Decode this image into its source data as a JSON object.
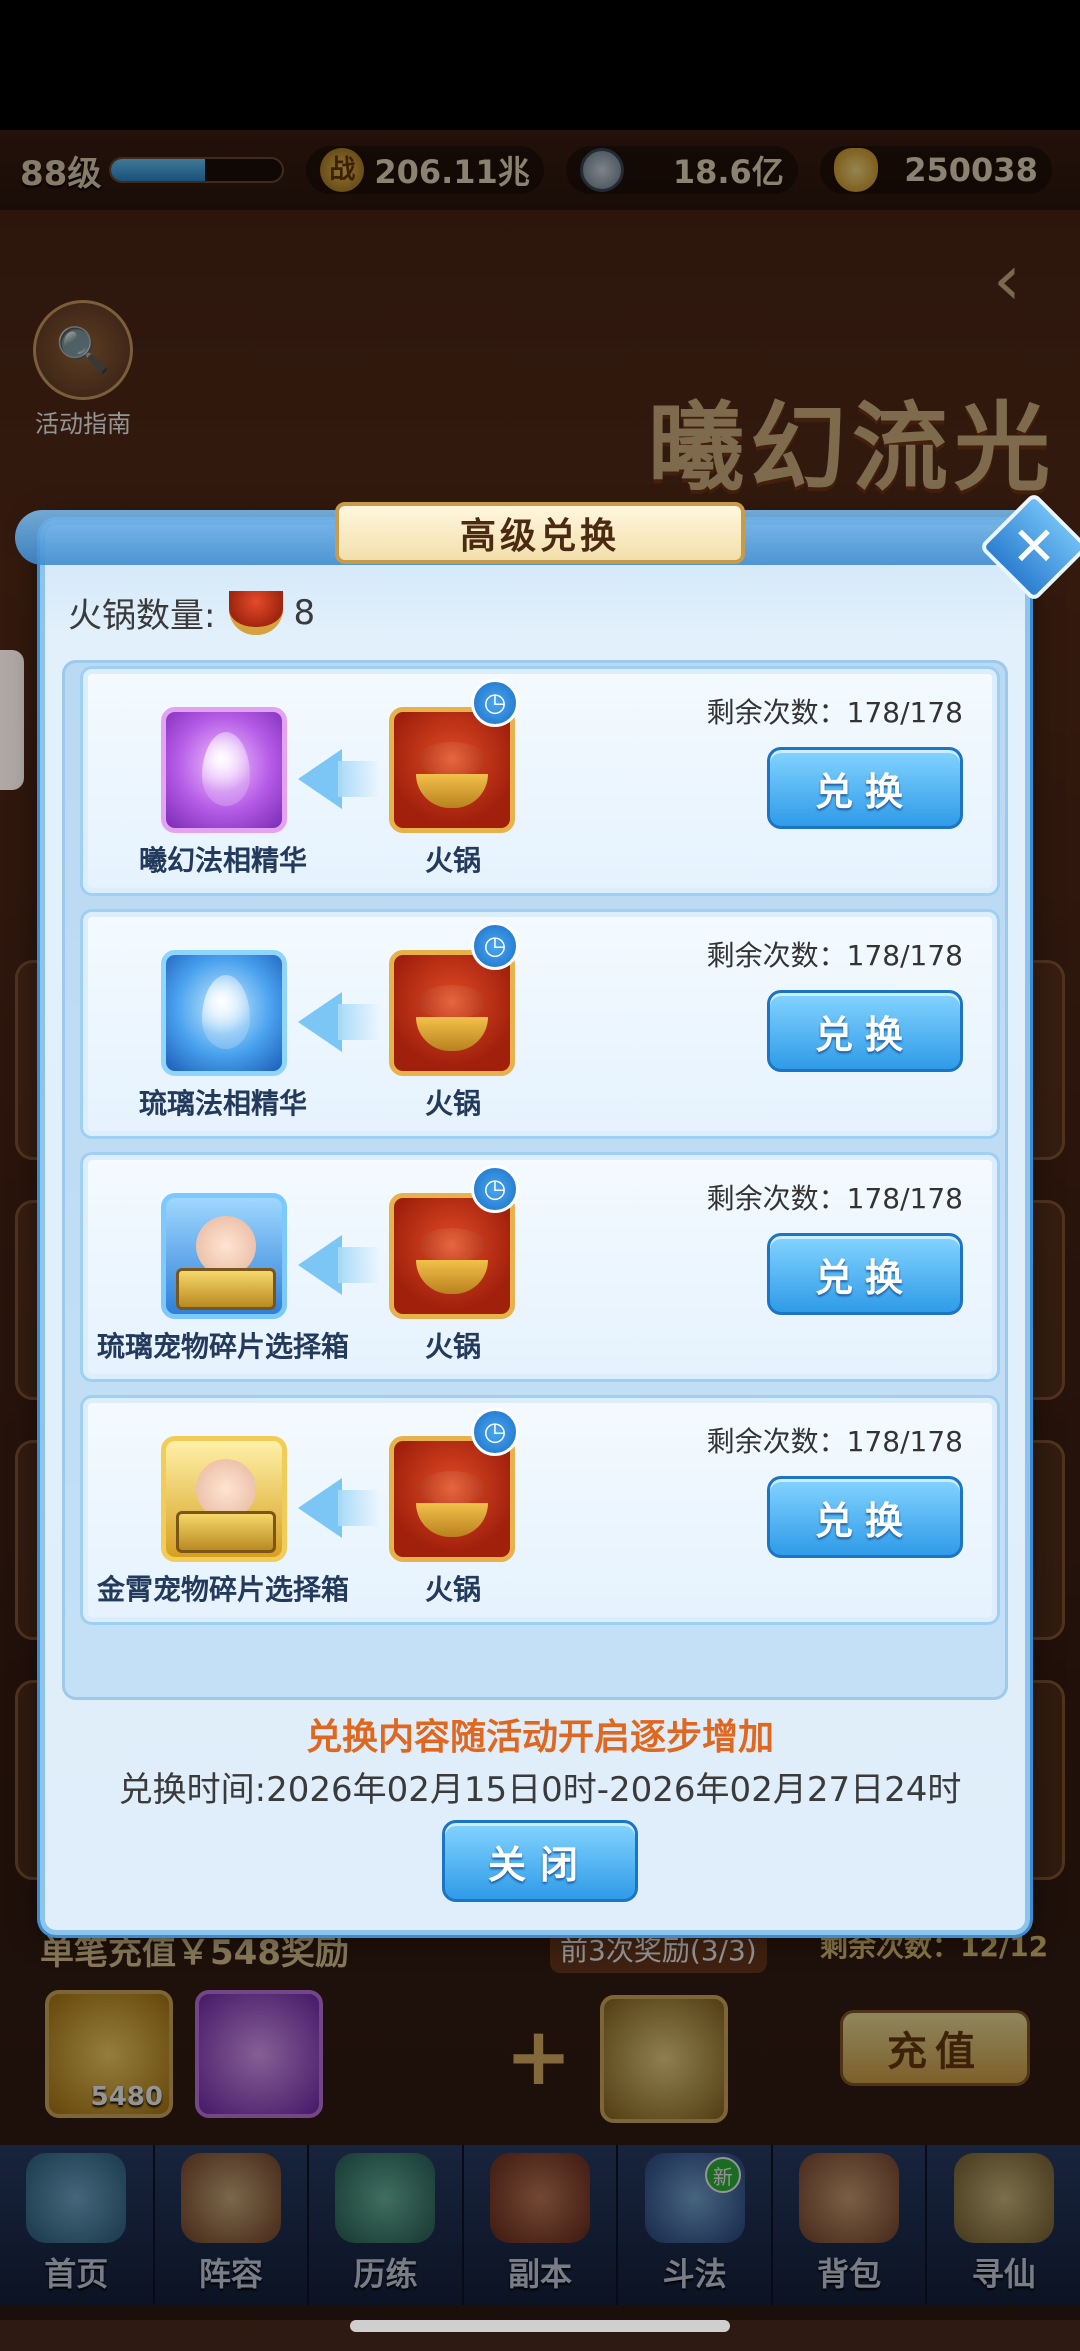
{
  "topbar": {
    "level": "88级",
    "exp_fraction": 0.55,
    "power_icon": "战",
    "power": "206.11兆",
    "silver": "18.6亿",
    "gold": "250038"
  },
  "background": {
    "event_title": "曦幻流光",
    "guide_label": "活动指南",
    "charge_title": "单笔充值￥548奖励",
    "charge_tag": "前3次奖励(3/3)",
    "charge_remain": "剩余次数：12/12",
    "gold_amount": "5480",
    "charge_button": "充值"
  },
  "modal": {
    "title": "高级兑换",
    "hotpot_label": "火锅数量:",
    "hotpot_count": "8",
    "rows": [
      {
        "item_name": "曦幻法相精华",
        "cost_name": "火锅",
        "remain": "剩余次数：178/178",
        "button": "兑换"
      },
      {
        "item_name": "琉璃法相精华",
        "cost_name": "火锅",
        "remain": "剩余次数：178/178",
        "button": "兑换"
      },
      {
        "item_name": "琉璃宠物碎片选择箱",
        "cost_name": "火锅",
        "remain": "剩余次数：178/178",
        "button": "兑换"
      },
      {
        "item_name": "金霄宠物碎片选择箱",
        "cost_name": "火锅",
        "remain": "剩余次数：178/178",
        "button": "兑换"
      }
    ],
    "notice": "兑换内容随活动开启逐步增加",
    "time": "兑换时间:2026年02月15日0时-2026年02月27日24时",
    "close_button": "关闭"
  },
  "navbar": {
    "items": [
      "首页",
      "阵容",
      "历练",
      "副本",
      "斗法",
      "背包",
      "寻仙"
    ],
    "new_badge": "新"
  },
  "colors": {
    "accent_blue": "#2f9be8",
    "notice_orange": "#e0671f"
  }
}
